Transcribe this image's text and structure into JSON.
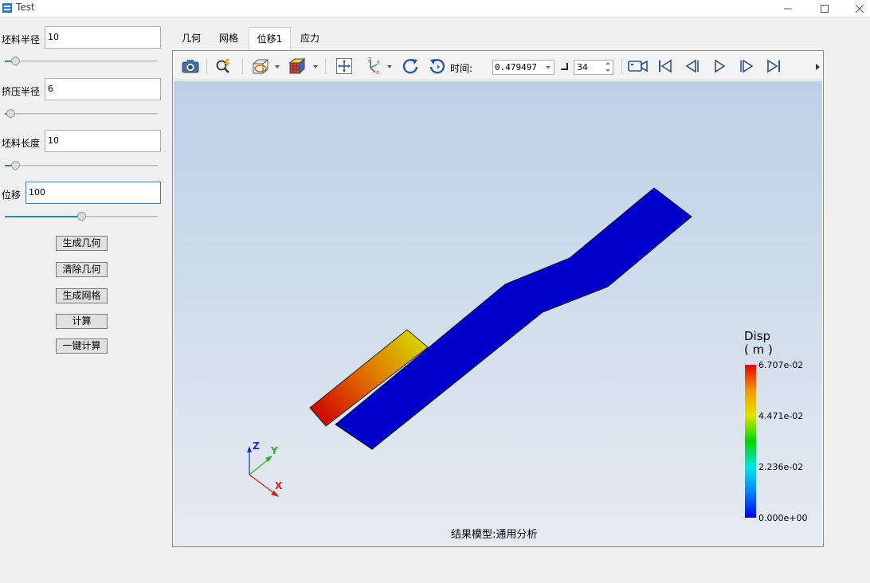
{
  "window": {
    "title": "Test",
    "icon": "app-icon"
  },
  "params": [
    {
      "label": "坯料半径",
      "value": "10",
      "slider_fraction": 0.07
    },
    {
      "label": "挤压半径",
      "value": "6",
      "slider_fraction": 0.04
    },
    {
      "label": "坯料长度",
      "value": "10",
      "slider_fraction": 0.07
    },
    {
      "label": "位移",
      "value": "100",
      "slider_fraction": 0.5
    }
  ],
  "actions": {
    "gen_geometry": "生成几何",
    "clear_geometry": "清除几何",
    "gen_mesh": "生成网格",
    "compute": "计算",
    "one_click": "一键计算"
  },
  "tabs": [
    {
      "label": "几何",
      "active": false
    },
    {
      "label": "网格",
      "active": false
    },
    {
      "label": "位移1",
      "active": true
    },
    {
      "label": "应力",
      "active": false
    }
  ],
  "toolbar": {
    "icons": [
      "camera-icon",
      "zoom-probe-icon",
      "view-box-icon",
      "color-cube-icon",
      "fit-view-icon",
      "axis-orient-icon",
      "rotate-left-icon",
      "rotate-right-icon",
      "video-icon",
      "first-frame-icon",
      "prev-frame-icon",
      "play-icon",
      "next-frame-icon",
      "last-frame-icon"
    ],
    "time_label": "时间:",
    "time_value": "0.479497",
    "frame_value": "34"
  },
  "viewport": {
    "result_model": "结果模型:通用分析",
    "legend": {
      "title": "Disp",
      "unit": "( m )",
      "ticks": [
        "6.707e-02",
        "4.471e-02",
        "2.236e-02",
        "0.000e+00"
      ]
    },
    "axes": {
      "x": "X",
      "y": "Y",
      "z": "Z"
    }
  },
  "colors": {
    "accent": "#3c7fb1",
    "part_blue": "#0000cc",
    "part_red": "#cc0000",
    "part_yellow": "#d8d800"
  }
}
